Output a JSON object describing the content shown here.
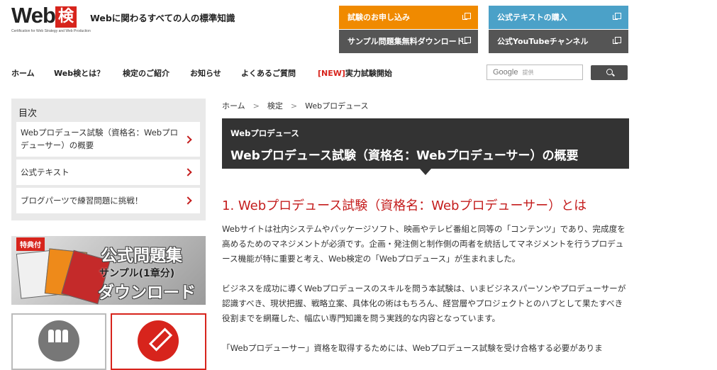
{
  "header": {
    "logo_text": "Web",
    "logo_kanji": "検",
    "logo_subtitle": "Certification for Web Strategy and Web Production",
    "tagline": "Webに関わるすべての人の標準知識",
    "buttons": {
      "apply": "試験のお申し込み",
      "sample": "サンプル問題集無料ダウンロード",
      "text": "公式テキストの購入",
      "youtube": "公式YouTubeチャンネル"
    },
    "colors": {
      "apply": "#f08a00",
      "text": "#4ba1c8",
      "dark": "#555555",
      "accent": "#d7241c"
    }
  },
  "nav": {
    "items": [
      "ホーム",
      "Web検とは？",
      "検定のご紹介",
      "お知らせ",
      "よくあるご質問"
    ],
    "new_tag": "[NEW]",
    "new_label": "実力試験開始"
  },
  "search": {
    "brand": "Google",
    "placeholder": "提供"
  },
  "sidebar": {
    "toc_title": "目次",
    "items": [
      "Webプロデュース試験（資格名：Webプロデューサー）の概要",
      "公式テキスト",
      "ブログパーツで練習問題に挑戦！"
    ],
    "banner": {
      "badge": "特典付",
      "line1": "公式問題集",
      "line2": "サンプル(1章分)",
      "line3": "ダウンロード"
    }
  },
  "main": {
    "breadcrumb": [
      "ホーム",
      "検定",
      "Webプロデュース"
    ],
    "breadcrumb_sep": ">",
    "category": "Webプロデュース",
    "title": "Webプロデュース試験（資格名：Webプロデューサー）の概要",
    "section_heading": "1. Webプロデュース試験（資格名：Webプロデューサー）とは",
    "paragraphs": [
      "Webサイトは社内システムやパッケージソフト、映画やテレビ番組と同等の「コンテンツ」であり、完成度を高めるためのマネジメントが必須です。企画・発注側と制作側の両者を統括してマネジメントを行うプロデュース機能が特に重要と考え、Web検定の「Webプロデュース」が生まれました。",
      "ビジネスを成功に導くWebプロデュースのスキルを問う本試験は、いまビジネスパーソンやプロデューサーが認識すべき、現状把握、戦略立案、具体化の術はもちろん、経営層やプロジェクトとのハブとして果たすべき役割までを網羅した、幅広い専門知識を問う実践的な内容となっています。",
      "「Webプロデューサー」資格を取得するためには、Webプロデュース試験を受け合格する必要がありま"
    ]
  }
}
